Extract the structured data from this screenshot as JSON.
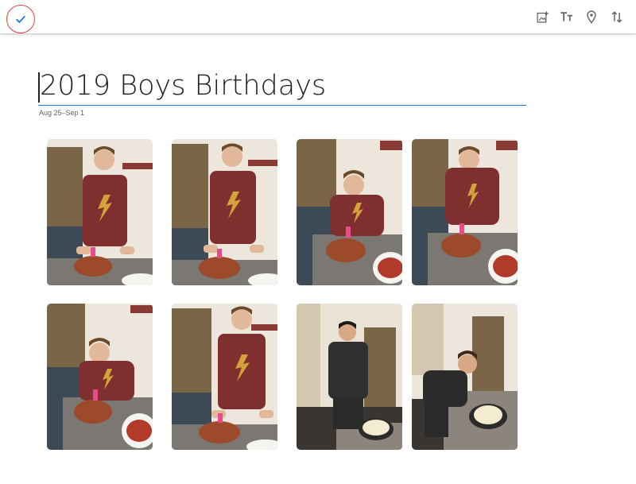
{
  "album": {
    "title": "2019 Boys Birthdays",
    "date_range": "Aug 25–Sep 1"
  },
  "toolbar": {
    "done_icon": "check-icon",
    "tools": [
      "add-photo-icon",
      "text-format-icon",
      "location-icon",
      "sort-icon"
    ]
  },
  "colors": {
    "accent": "#1a73e8",
    "highlight_circle": "#e0413a",
    "icon_gray": "#5f6368"
  },
  "photos": [
    {
      "scene": "kitchen",
      "pose": "standing"
    },
    {
      "scene": "kitchen",
      "pose": "standing"
    },
    {
      "scene": "kitchen",
      "pose": "blowing"
    },
    {
      "scene": "kitchen",
      "pose": "blowing"
    },
    {
      "scene": "kitchen",
      "pose": "blowing"
    },
    {
      "scene": "kitchen",
      "pose": "laughing"
    },
    {
      "scene": "hallway",
      "pose": "dark-shirt"
    },
    {
      "scene": "hallway",
      "pose": "dark-blowing"
    }
  ]
}
